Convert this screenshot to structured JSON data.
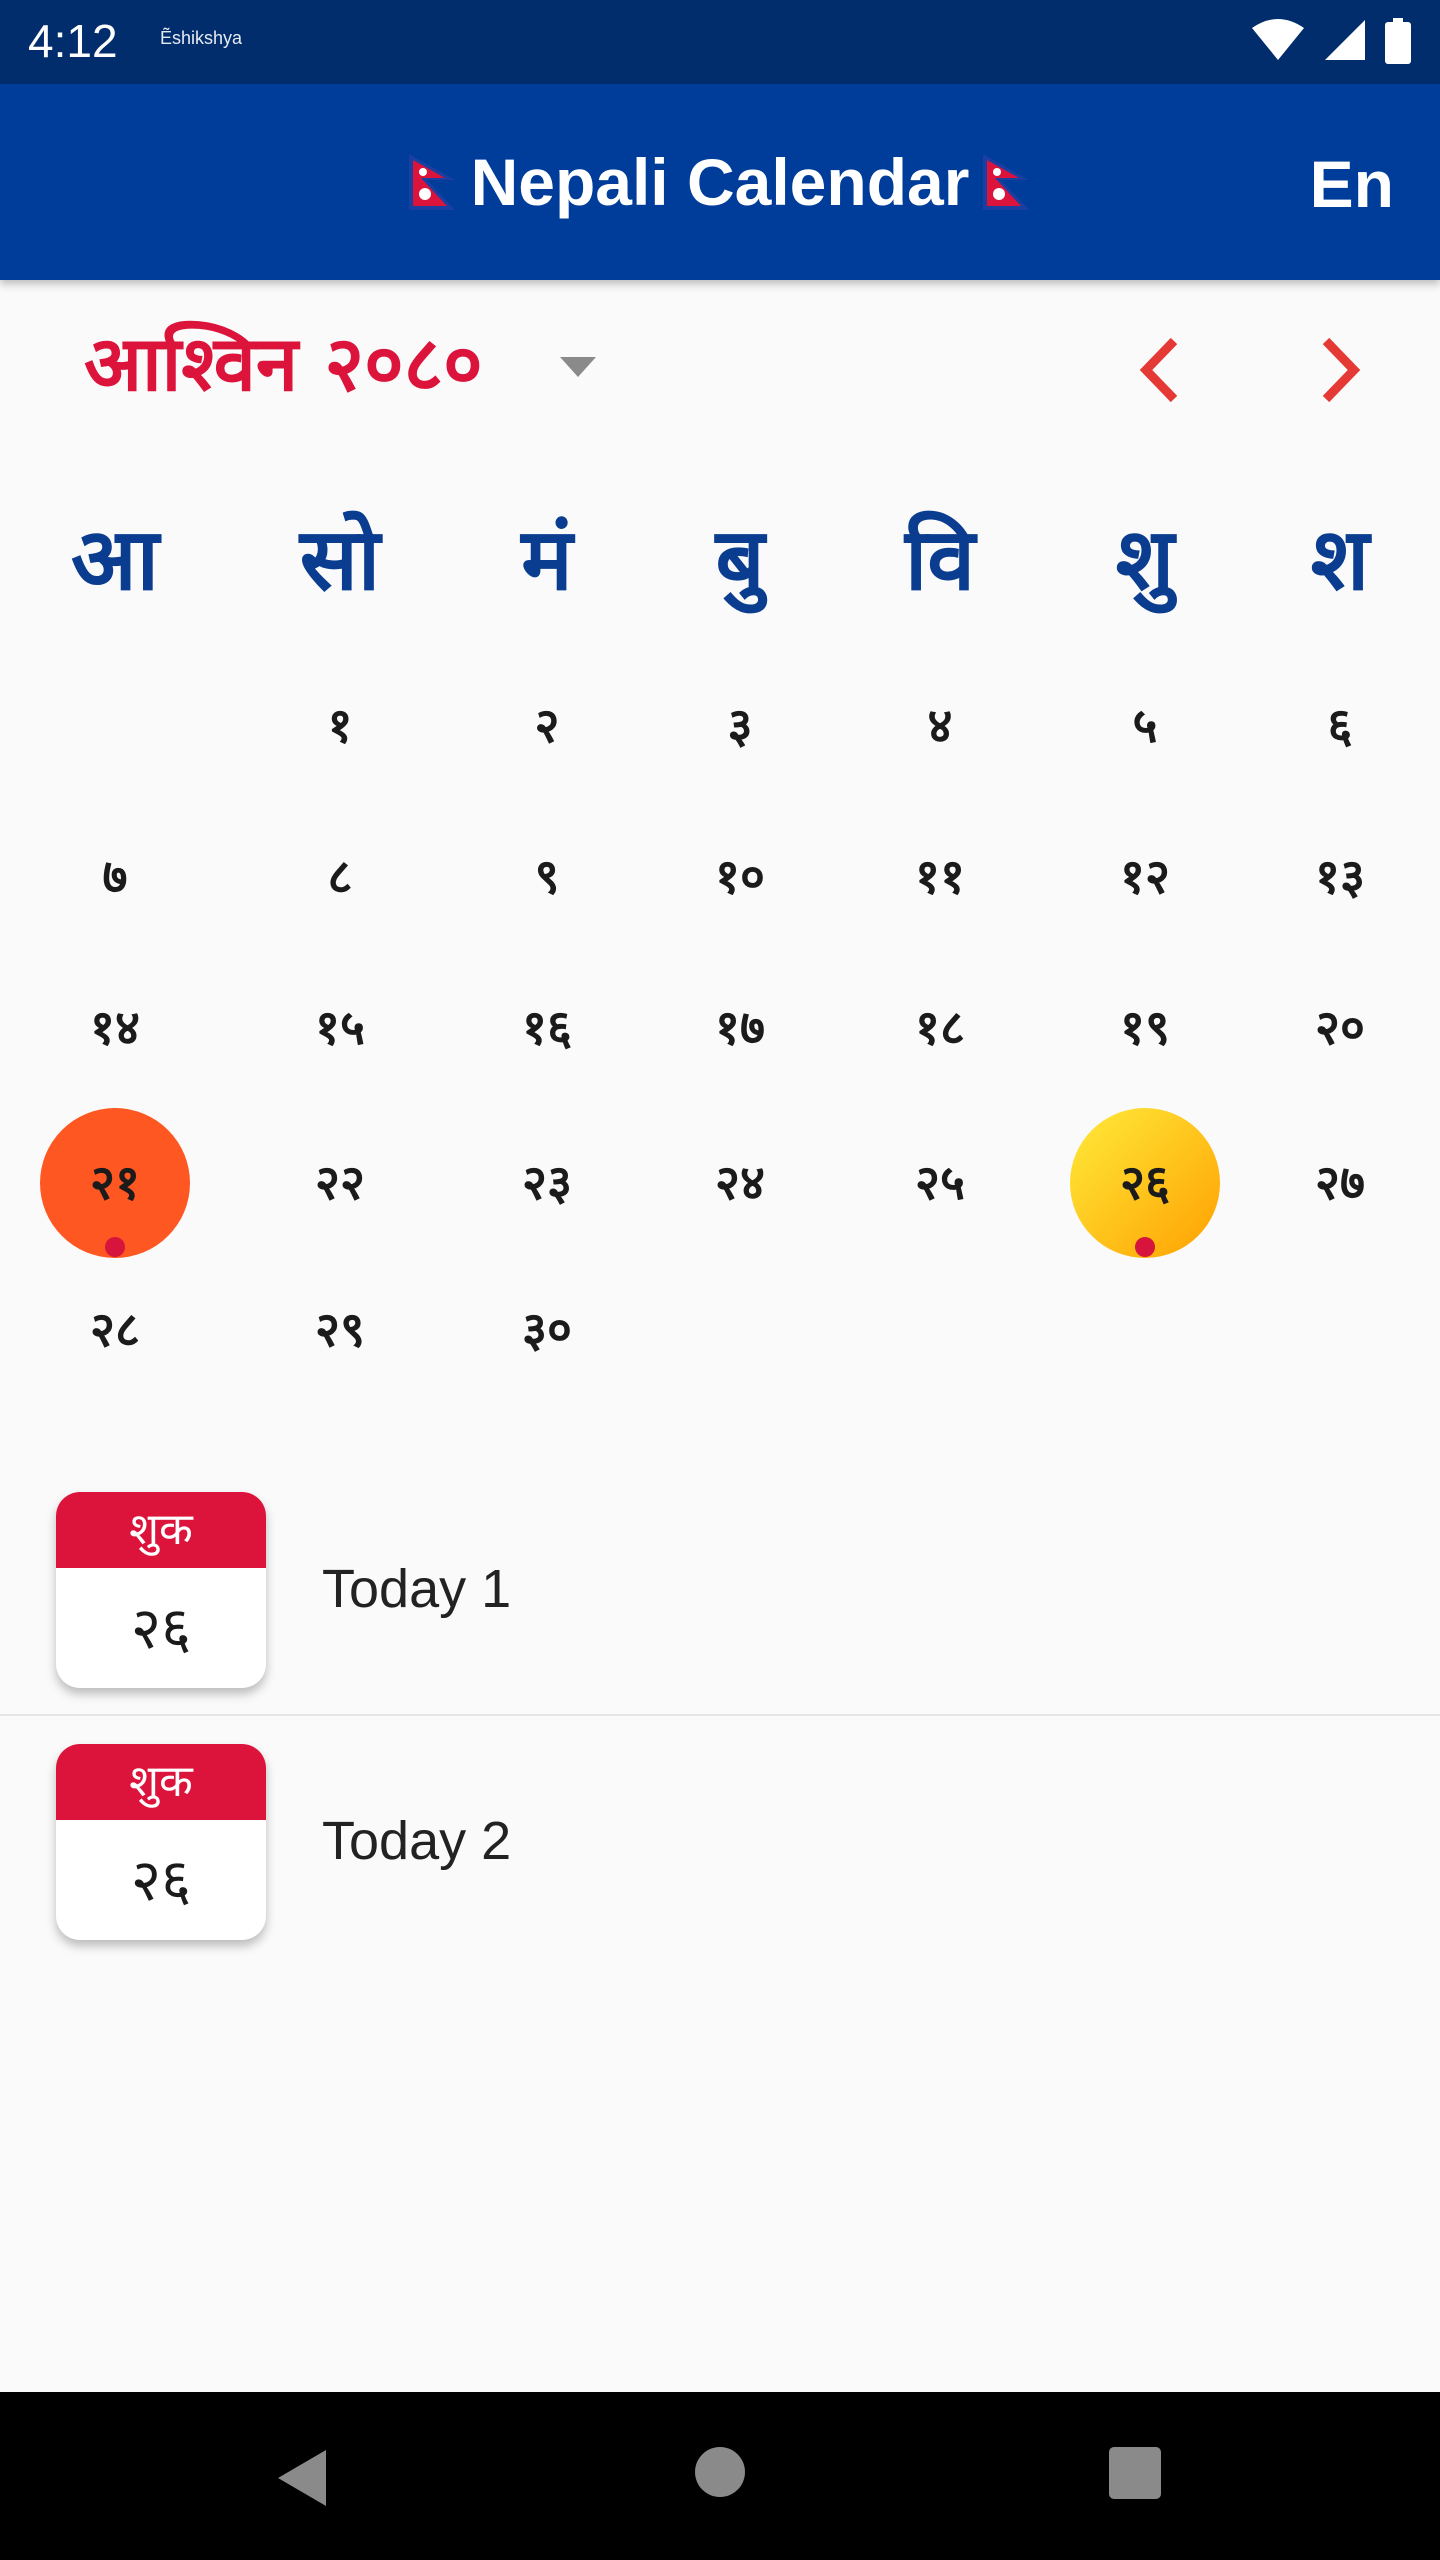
{
  "status_bar": {
    "time": "4:12",
    "notification_text": "Ẽshikshya",
    "icons": [
      "wifi-icon",
      "signal-icon",
      "battery-icon"
    ]
  },
  "app_bar": {
    "title": "Nepali Calendar",
    "lang_button": "En",
    "flag_icon": "nepal-flag-icon",
    "color": "#003c99"
  },
  "calendar": {
    "month_title": "आश्विन २०८०",
    "accent_color": "#dc143c",
    "weekdays": [
      "आ",
      "सो",
      "मं",
      "बु",
      "वि",
      "शु",
      "श"
    ],
    "weeks": [
      [
        "",
        "१",
        "२",
        "३",
        "४",
        "५",
        "६"
      ],
      [
        "७",
        "८",
        "९",
        "१०",
        "११",
        "१२",
        "१३"
      ],
      [
        "१४",
        "१५",
        "१६",
        "१७",
        "१८",
        "१९",
        "२०"
      ],
      [
        "२१",
        "२२",
        "२३",
        "२४",
        "२५",
        "२६",
        "२७"
      ],
      [
        "२८",
        "२९",
        "३०",
        "",
        "",
        "",
        ""
      ]
    ],
    "highlighted_days": [
      {
        "day": "२१",
        "style": "circle-saturday",
        "has_event": true
      },
      {
        "day": "२६",
        "style": "circle-today",
        "has_event": true
      }
    ]
  },
  "events": [
    {
      "weekday": "शुक",
      "day": "२६",
      "title": "Today 1"
    },
    {
      "weekday": "शुक",
      "day": "२६",
      "title": "Today 2"
    }
  ],
  "nav_bar": {
    "icons": [
      "back-icon",
      "home-icon",
      "recents-icon"
    ]
  }
}
